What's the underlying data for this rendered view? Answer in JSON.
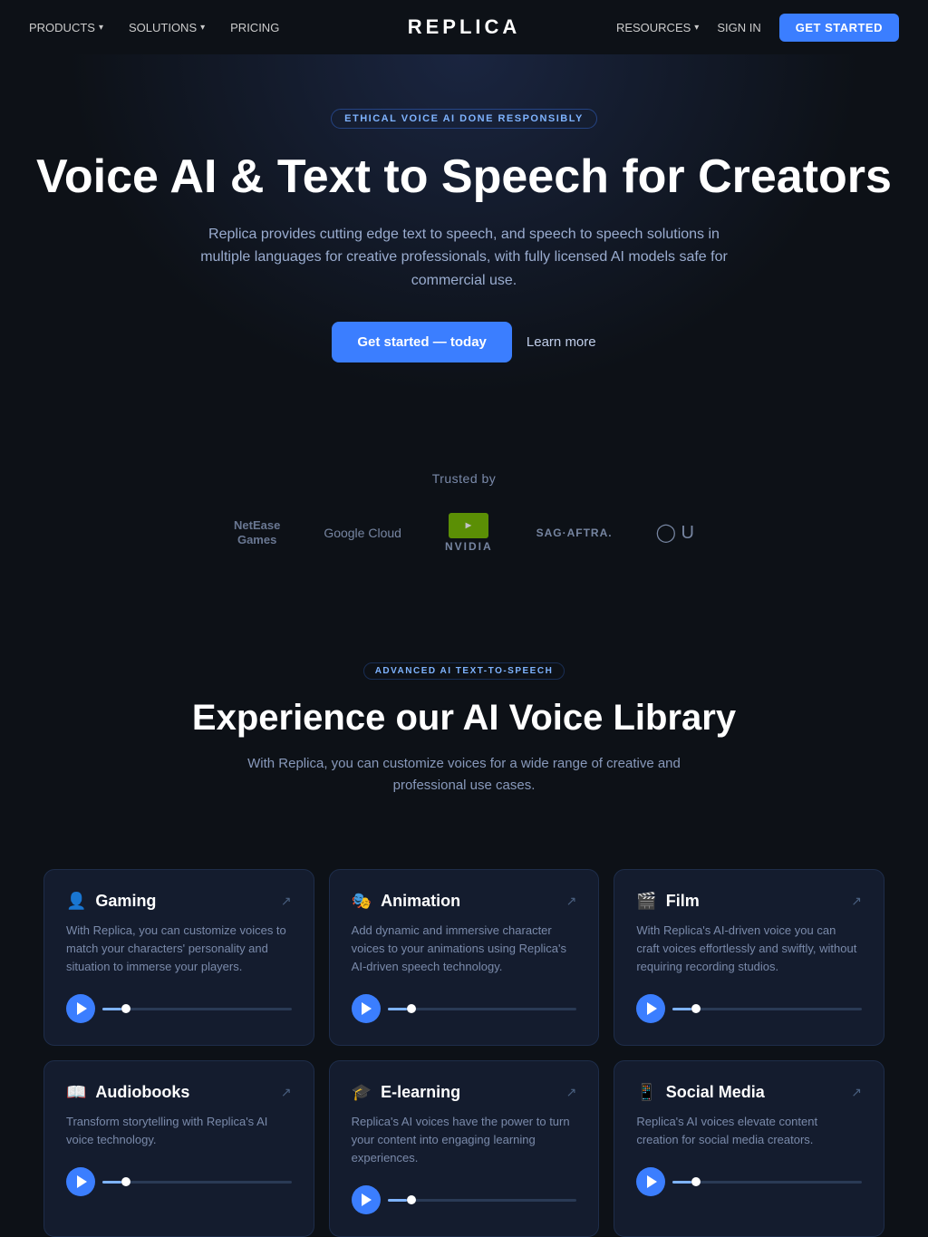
{
  "nav": {
    "logo": "REPLICA",
    "left_links": [
      {
        "label": "PRODUCTS",
        "has_dropdown": true
      },
      {
        "label": "SOLUTIONS",
        "has_dropdown": true
      },
      {
        "label": "PRICING",
        "has_dropdown": false
      }
    ],
    "right_links": [
      {
        "label": "RESOURCES",
        "has_dropdown": true
      },
      {
        "label": "SIGN IN",
        "has_dropdown": false
      }
    ],
    "cta_label": "GET STARTED"
  },
  "hero": {
    "badge": "ETHICAL VOICE AI DONE RESPONSIBLY",
    "heading": "Voice AI & Text to Speech for Creators",
    "subtext": "Replica provides cutting edge text to speech, and speech to speech solutions in multiple languages for creative professionals, with fully licensed AI models safe for commercial use.",
    "cta_primary": "Get started — today",
    "cta_secondary": "Learn more"
  },
  "trusted": {
    "label": "Trusted by",
    "logos": [
      {
        "name": "NetEase Games"
      },
      {
        "name": "Google Cloud"
      },
      {
        "name": "NVIDIA"
      },
      {
        "name": "SAG-AFTRA"
      },
      {
        "name": "Unity"
      }
    ]
  },
  "voice_library": {
    "badge": "ADVANCED AI TEXT-TO-SPEECH",
    "heading": "Experience our AI Voice Library",
    "subtext": "With Replica, you can customize voices for a wide range of creative and professional use cases.",
    "cards": [
      {
        "icon": "👤",
        "title": "Gaming",
        "description": "With Replica, you can customize voices to match your characters' personality and situation to immerse your players.",
        "external_link": true
      },
      {
        "icon": "🎭",
        "title": "Animation",
        "description": "Add dynamic and immersive character voices to your animations using Replica's AI-driven speech technology.",
        "external_link": true
      },
      {
        "icon": "🎬",
        "title": "Film",
        "description": "With Replica's AI-driven voice you can craft voices effortlessly and swiftly, without requiring recording studios.",
        "external_link": true
      },
      {
        "icon": "📖",
        "title": "Audiobooks",
        "description": "Transform storytelling with Replica's AI voice technology.",
        "external_link": true
      },
      {
        "icon": "🎓",
        "title": "E-learning",
        "description": "Replica's AI voices have the power to turn your content into engaging learning experiences.",
        "external_link": true
      },
      {
        "icon": "📱",
        "title": "Social Media",
        "description": "Replica's AI voices elevate content creation for social media creators.",
        "external_link": true
      }
    ]
  }
}
